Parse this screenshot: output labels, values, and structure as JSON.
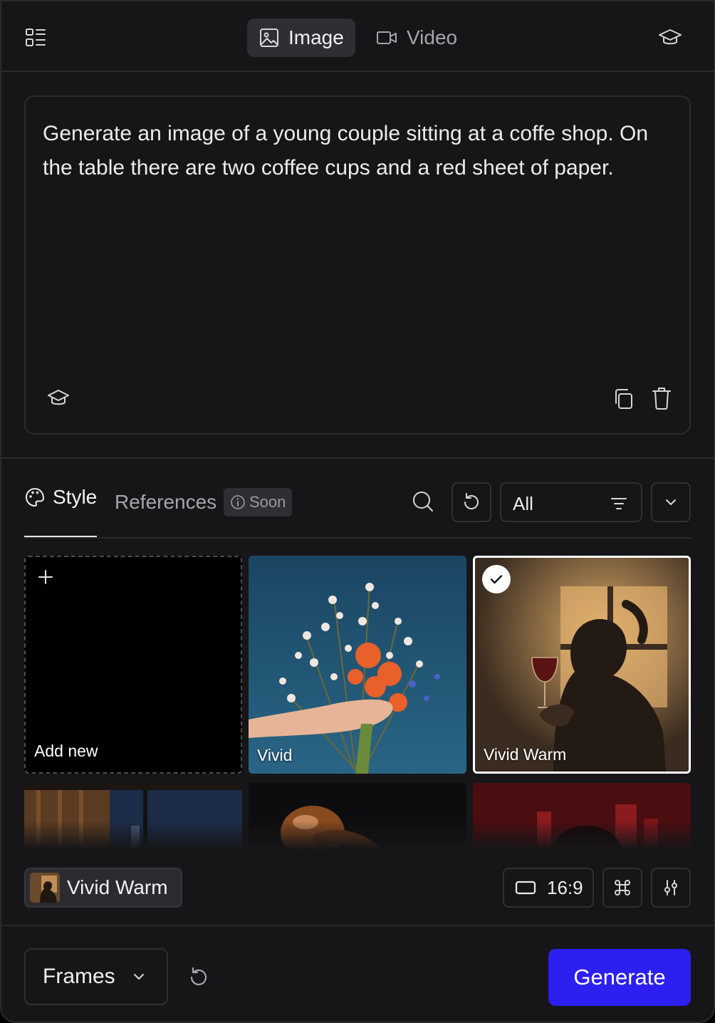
{
  "header": {
    "tabs": [
      {
        "label": "Image",
        "icon": "image-icon",
        "active": true
      },
      {
        "label": "Video",
        "icon": "video-camera-icon",
        "active": false
      }
    ]
  },
  "prompt": {
    "text": "Generate an image of a young couple sitting at a coffe shop. On the table there are two coffee cups and a red sheet of paper."
  },
  "styles_panel": {
    "tabs": [
      {
        "label": "Style",
        "icon": "palette-icon",
        "active": true
      },
      {
        "label": "References",
        "active": false
      }
    ],
    "soon_badge": "Soon",
    "filter_value": "All",
    "cards": [
      {
        "label": "Add new",
        "type": "add"
      },
      {
        "label": "Vivid",
        "type": "style"
      },
      {
        "label": "Vivid Warm",
        "type": "style",
        "selected": true
      }
    ]
  },
  "settings": {
    "selected_style": "Vivid Warm",
    "aspect_ratio": "16:9"
  },
  "footer": {
    "mode_select": "Frames",
    "generate_label": "Generate"
  },
  "colors": {
    "background": "#161618",
    "accent": "#2d1ff0",
    "active_tab_bg": "#2e2f33"
  }
}
